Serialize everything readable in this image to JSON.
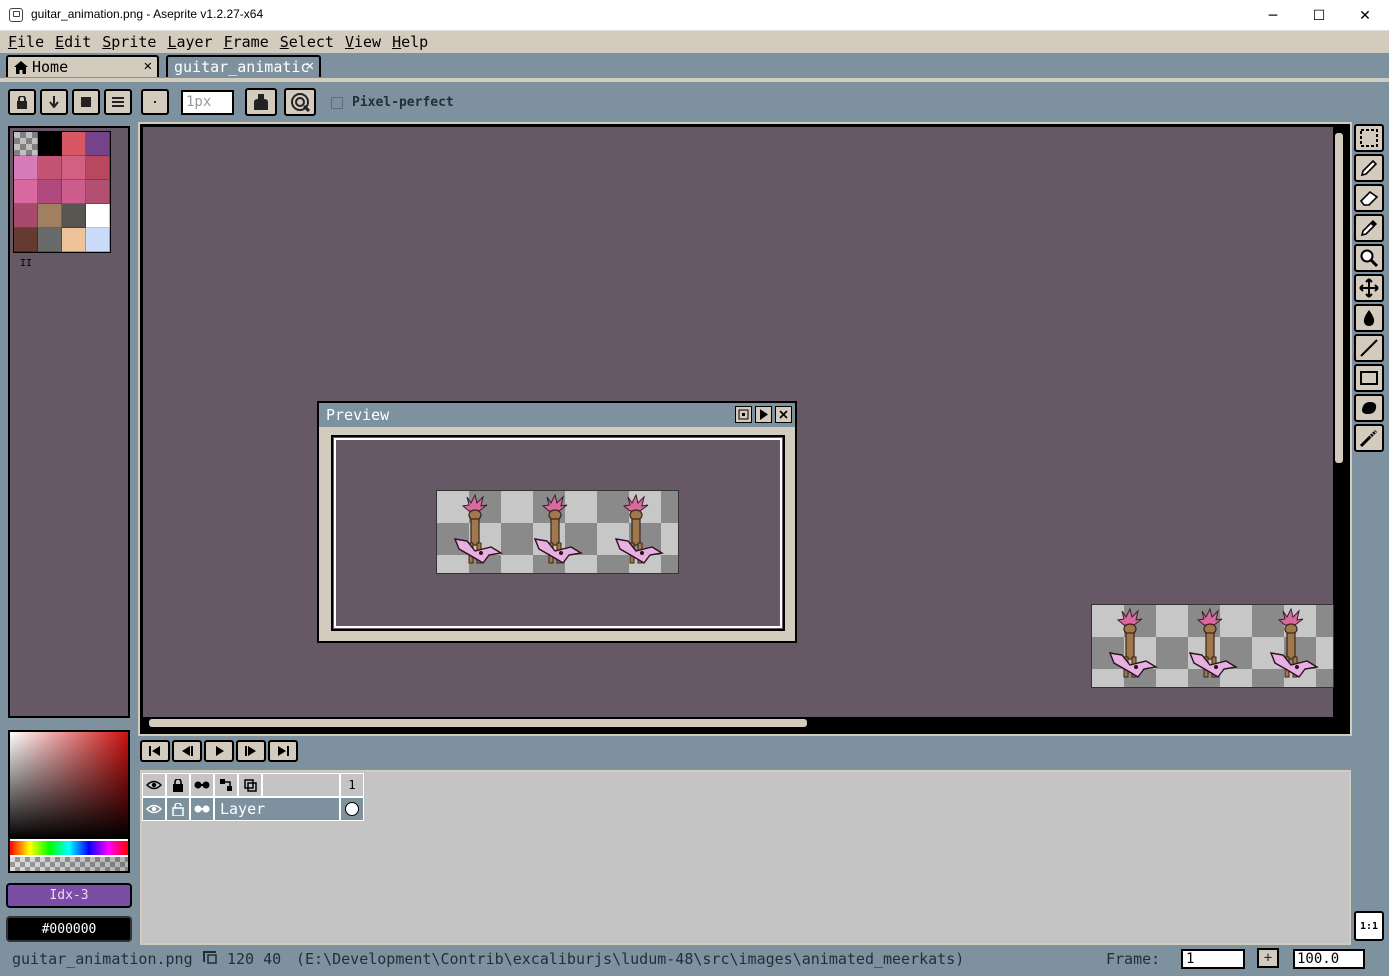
{
  "window": {
    "title": "guitar_animation.png - Aseprite v1.2.27-x64",
    "minimize": "─",
    "maximize": "☐",
    "close": "✕"
  },
  "menu": [
    {
      "first": "F",
      "rest": "ile"
    },
    {
      "first": "E",
      "rest": "dit"
    },
    {
      "first": "S",
      "rest": "prite"
    },
    {
      "first": "L",
      "rest": "ayer"
    },
    {
      "first": "F",
      "rest": "rame"
    },
    {
      "first": "S",
      "rest": "elect"
    },
    {
      "first": "V",
      "rest": "iew"
    },
    {
      "first": "H",
      "rest": "elp"
    }
  ],
  "tabs": {
    "home": "Home",
    "file": "guitar_animatic",
    "close": "✕"
  },
  "context_bar": {
    "brush_size_placeholder": "1px",
    "pixel_perfect": "Pixel-perfect",
    "pixel_perfect_checked": false
  },
  "palette": {
    "colors": [
      "#808080",
      "#000000",
      "#d95763",
      "#76428a",
      "#d77bba",
      "#c25472",
      "#d35f82",
      "#b8485f",
      "#d96aa0",
      "#b1497c",
      "#cc5d8c",
      "#b24f72",
      "#a84a6b",
      "#a08060",
      "#595652",
      "#ffffff",
      "#663931",
      "#696a6a",
      "#eec39a",
      "#cbdbfc"
    ],
    "handle": "II"
  },
  "color": {
    "index_label": "Idx-3",
    "hex_label": "#000000"
  },
  "preview": {
    "title": "Preview",
    "frames_shown": 3
  },
  "sprite": {
    "frames": 3
  },
  "tools": [
    "marquee-icon",
    "pencil-icon",
    "eraser-icon",
    "eyedropper-icon",
    "zoom-icon",
    "move-icon",
    "paint-bucket-icon",
    "line-icon",
    "rectangle-icon",
    "contour-icon",
    "blur-icon"
  ],
  "timeline": {
    "frame_number": "1",
    "layer_name": "Layer"
  },
  "status": {
    "filename": "guitar_animation.png",
    "size": "120 40",
    "path": "(E:\\Development\\Contrib\\excaliburjs\\ludum-48\\src\\images\\animated_meerkats)",
    "frame_label": "Frame:",
    "frame_value": "1",
    "plus": "+",
    "zoom": "100.0"
  },
  "colors": {
    "face": "#d3cbbd",
    "chrome": "#7d929e",
    "canvas_bg": "#675866",
    "accent": "#7b4da5"
  }
}
